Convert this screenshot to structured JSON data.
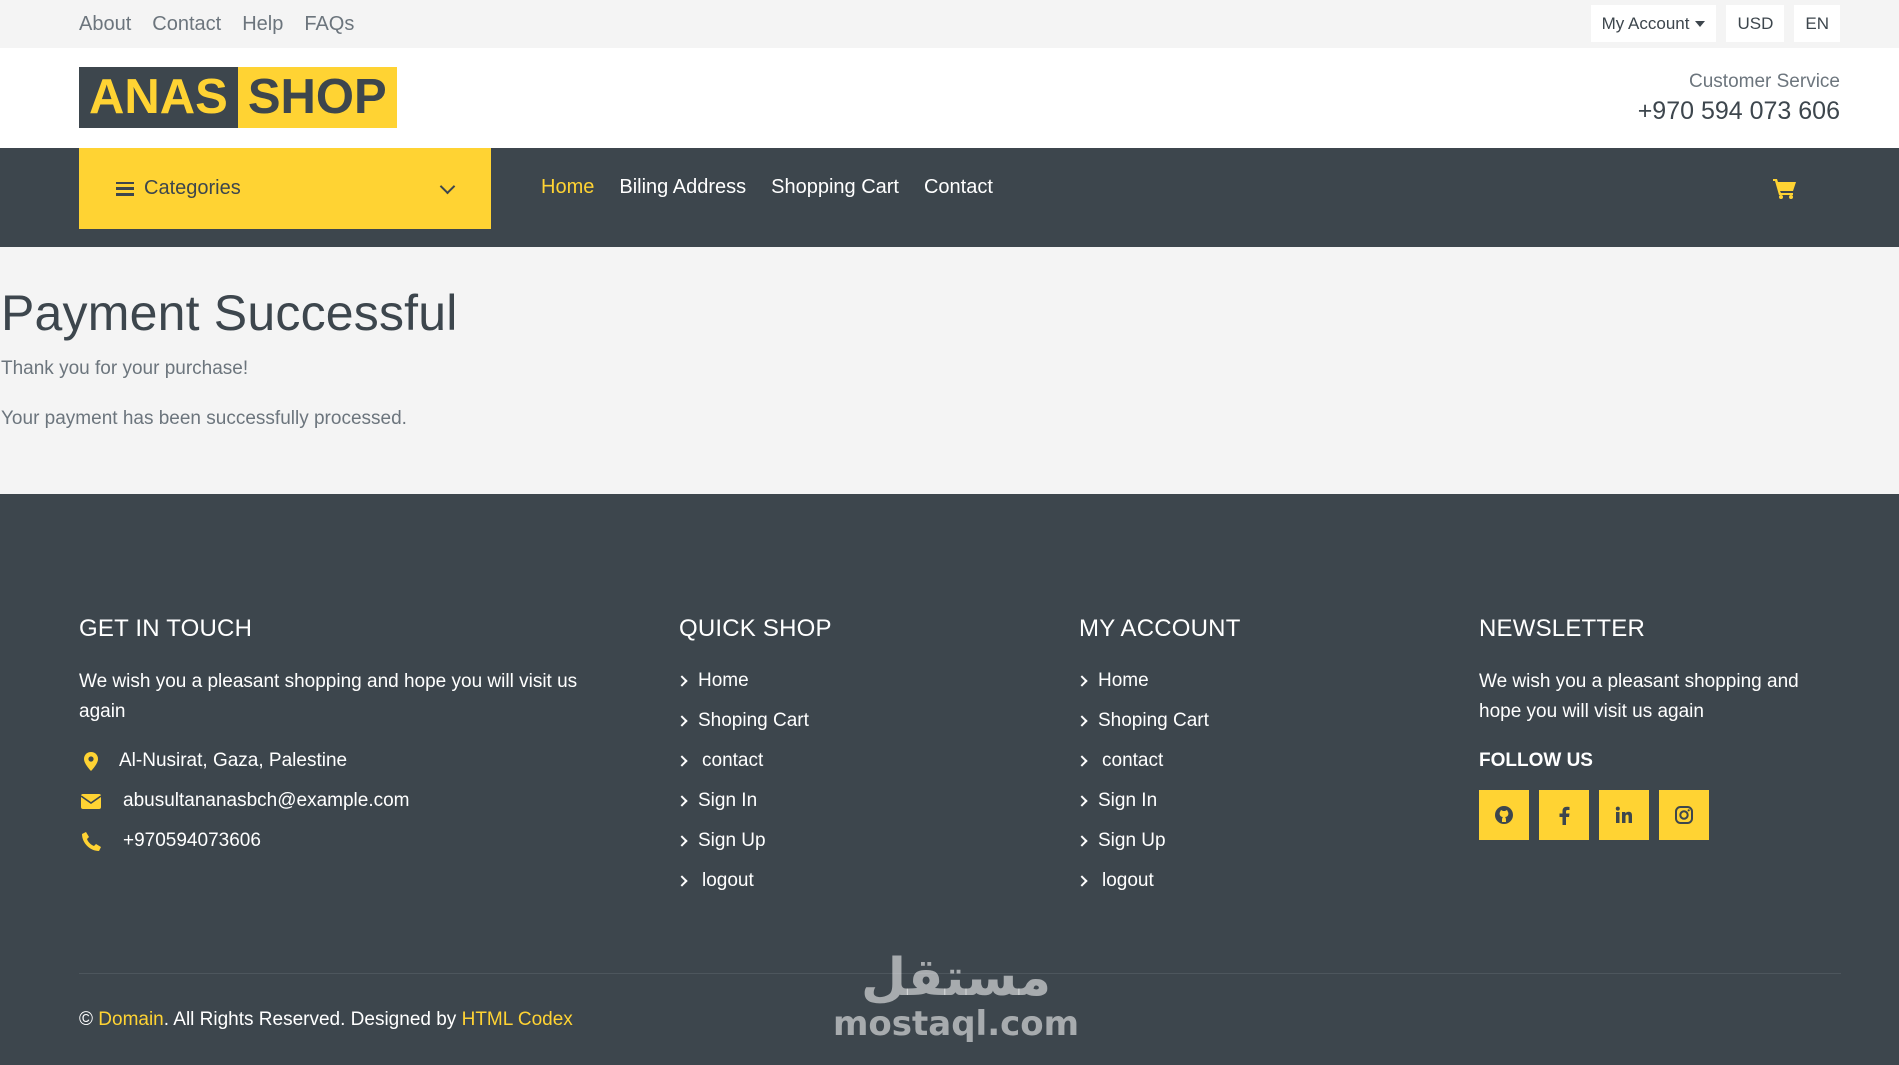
{
  "topbar": {
    "links": [
      "About",
      "Contact",
      "Help",
      "FAQs"
    ],
    "account_label": "My Account",
    "currency": "USD",
    "language": "EN"
  },
  "header": {
    "logo_part1": "ANAS",
    "logo_part2": "SHOP",
    "cs_label": "Customer Service",
    "cs_phone": "+970 594 073 606"
  },
  "navbar": {
    "categories_label": "Categories",
    "links": [
      "Home",
      "Biling Address",
      "Shopping Cart",
      "Contact"
    ],
    "active": "Home"
  },
  "main": {
    "title": "Payment Successful",
    "line1": "Thank you for your purchase!",
    "line2": "Your payment has been successfully processed."
  },
  "footer": {
    "touch": {
      "title": "GET IN TOUCH",
      "text": "We wish you a pleasant shopping and hope you will visit us again",
      "address": "Al-Nusirat, Gaza, Palestine",
      "email": "abusultananasbch@example.com",
      "phone": "+970594073606"
    },
    "quick_shop": {
      "title": "QUICK SHOP",
      "items": [
        "Home",
        "Shoping Cart",
        "contact",
        "Sign In",
        "Sign Up",
        "logout"
      ]
    },
    "my_account": {
      "title": "MY ACCOUNT",
      "items": [
        "Home",
        "Shoping Cart",
        "contact",
        "Sign In",
        "Sign Up",
        "logout"
      ]
    },
    "newsletter": {
      "title": "NEWSLETTER",
      "text": "We wish you a pleasant shopping and hope you will visit us again",
      "follow": "FOLLOW US",
      "socials": [
        "github-icon",
        "facebook-icon",
        "linkedin-icon",
        "instagram-icon"
      ]
    },
    "copyright": {
      "symbol": "©",
      "domain": "Domain",
      "middle": ". All Rights Reserved. Designed by",
      "designer": "HTML Codex"
    }
  },
  "watermark": {
    "arabic": "مستقل",
    "latin": "mostaql.com"
  },
  "colors": {
    "accent": "#ffd333",
    "dark": "#3d464d",
    "light_bg": "#f4f4f4"
  }
}
